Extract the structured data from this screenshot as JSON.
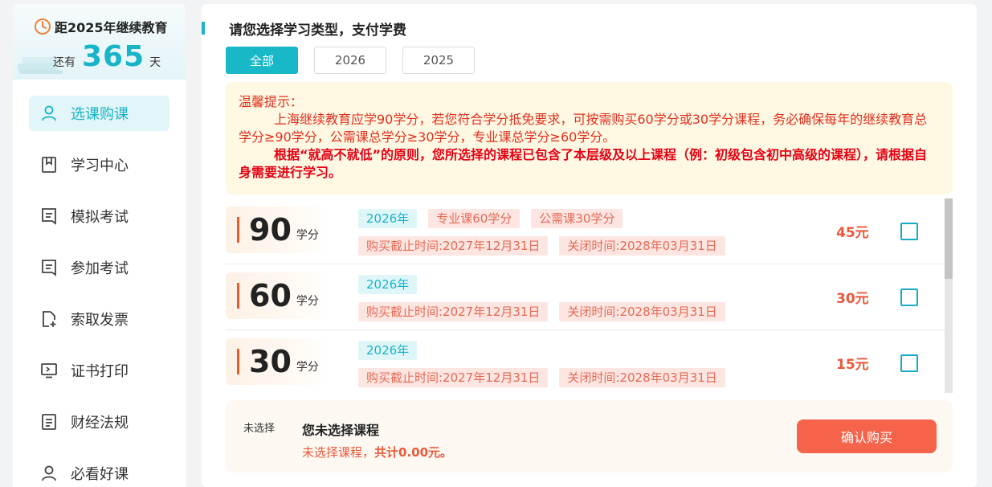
{
  "sidebar": {
    "countdown": {
      "title": "距2025年继续教育",
      "prefix": "还有",
      "days": "365",
      "suffix": "天"
    },
    "items": [
      {
        "label": "选课购课",
        "icon": "user-icon",
        "active": true
      },
      {
        "label": "学习中心",
        "icon": "bookmark-icon"
      },
      {
        "label": "模拟考试",
        "icon": "document-icon"
      },
      {
        "label": "参加考试",
        "icon": "document-icon"
      },
      {
        "label": "索取发票",
        "icon": "file-add-icon"
      },
      {
        "label": "证书打印",
        "icon": "monitor-icon"
      },
      {
        "label": "财经法规",
        "icon": "notes-icon"
      },
      {
        "label": "必看好课",
        "icon": "user-icon"
      }
    ]
  },
  "main": {
    "section_title": "请您选择学习类型，支付学费",
    "tabs": [
      {
        "label": "全部",
        "active": true
      },
      {
        "label": "2026"
      },
      {
        "label": "2025"
      }
    ],
    "tips": {
      "title": "温馨提示：",
      "line1": "上海继续教育应学90学分，若您符合学分抵免要求，可按需购买60学分或30学分课程，务必确保每年的继续教育总学分≥90学分，公需课总学分≥30学分，专业课总学分≥60学分。",
      "line2": "根据“就高不就低”的原则，您所选择的课程已包含了本层级及以上课程（例：初级包含初中高级的课程），请根据自身需要进行学习。"
    },
    "courses": [
      {
        "credits": "90",
        "unit": "学分",
        "year": "2026年",
        "cat1": "专业课60学分",
        "cat2": "公需课30学分",
        "deadline": "购买截止时间:2027年12月31日",
        "close": "关闭时间:2028年03月31日",
        "price": "45元"
      },
      {
        "credits": "60",
        "unit": "学分",
        "year": "2026年",
        "deadline": "购买截止时间:2027年12月31日",
        "close": "关闭时间:2028年03月31日",
        "price": "30元"
      },
      {
        "credits": "30",
        "unit": "学分",
        "year": "2026年",
        "deadline": "购买截止时间:2027年12月31日",
        "close": "关闭时间:2028年03月31日",
        "price": "15元"
      }
    ],
    "summary": {
      "label": "未选择",
      "title": "您未选择课程",
      "sub_prefix": "未选择课程，",
      "sub_total": "共计0.00元。",
      "button": "确认购买"
    }
  },
  "colors": {
    "accent": "#18b4c8",
    "price": "#e8593a",
    "warning": "#e60012",
    "button": "#f5634a"
  }
}
